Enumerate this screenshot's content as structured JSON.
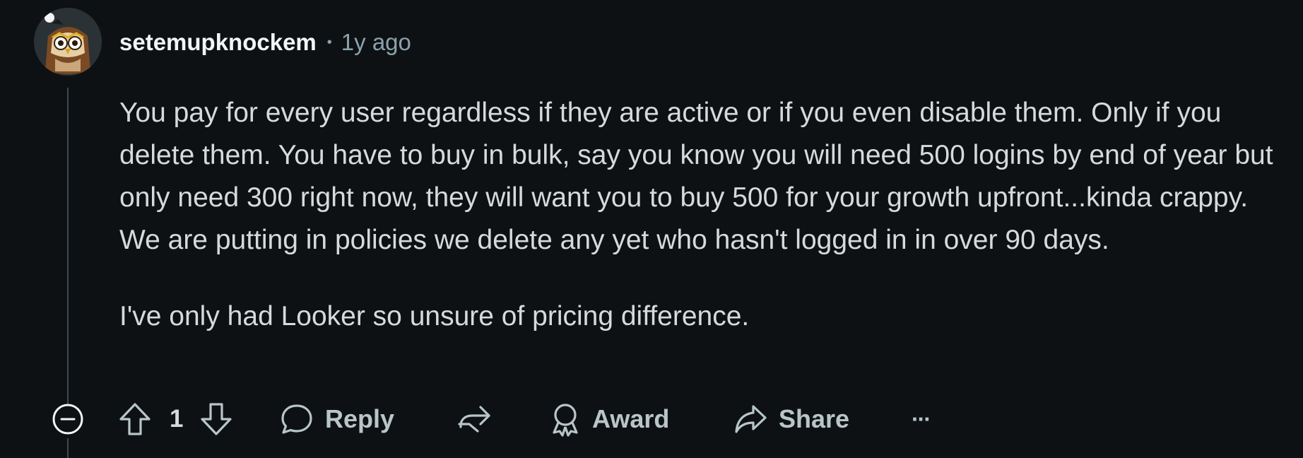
{
  "comment": {
    "username": "setemupknockem",
    "separator": "•",
    "age": "1y ago",
    "body": [
      "You pay for every user regardless if they are active or if you even disable them. Only if you delete them. You have to buy in bulk, say you know you will need 500 logins by end of year but only need 300 right now, they will want you to buy 500 for your growth upfront...kinda crappy. We are putting in policies we delete any yet who hasn't logged in in over 90 days.",
      "I've only had Looker so unsure of pricing difference."
    ]
  },
  "actions": {
    "score": "1",
    "reply_label": "Reply",
    "award_label": "Award",
    "share_label": "Share",
    "more_label": "···"
  },
  "icons": {
    "collapse": "collapse-minus-icon",
    "upvote": "upvote-arrow-icon",
    "downvote": "downvote-arrow-icon",
    "reply": "speech-bubble-icon",
    "crosspost": "crosspost-icon",
    "award": "award-medal-icon",
    "share": "share-arrow-icon",
    "more": "more-dots-icon"
  },
  "colors": {
    "background": "#0e1113",
    "text": "#d7dadc",
    "muted": "#8ba2ad",
    "icon": "#b8c5c9",
    "thread_line": "#3e4a50"
  }
}
